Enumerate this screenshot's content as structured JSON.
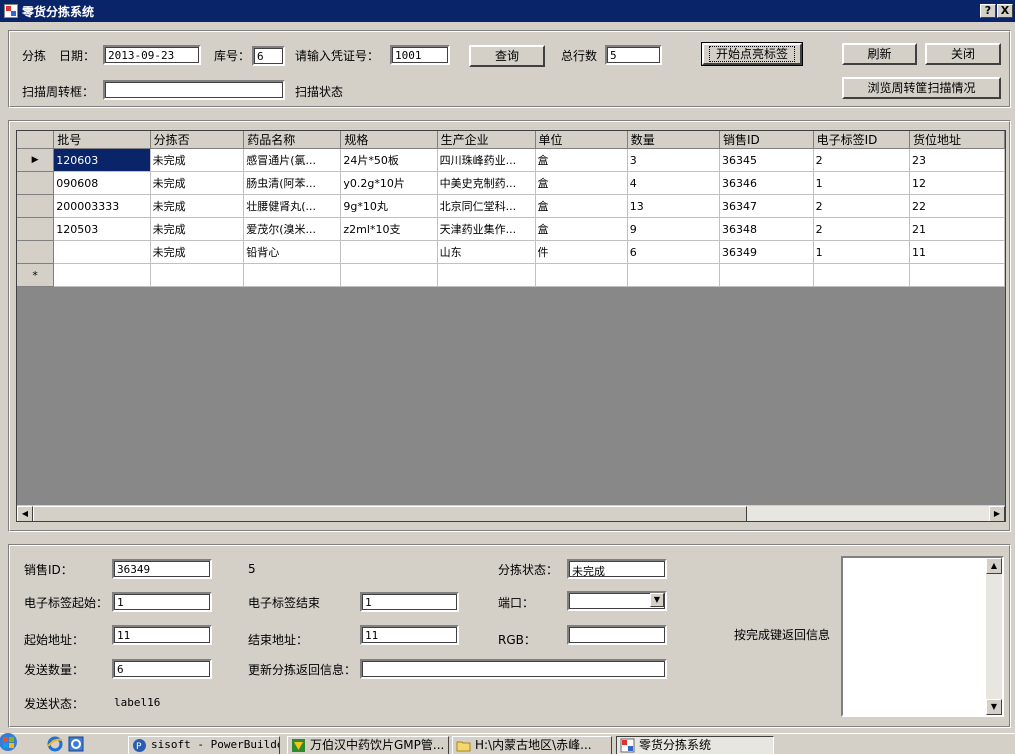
{
  "window": {
    "title": "零货分拣系统",
    "help_btn": "?",
    "close_btn": "X"
  },
  "top": {
    "fenjian_label": "分拣",
    "date_label": "日期：",
    "date_value": "2013-09-23",
    "kuhao_label": "库号：",
    "kuhao_value": "6",
    "voucher_label": "请输入凭证号：",
    "voucher_value": "1001",
    "query_btn": "查询",
    "total_label": "总行数",
    "total_value": "5",
    "start_btn": "开始点亮标签",
    "refresh_btn": "刷新",
    "close_btn": "关闭",
    "scan_label": "扫描周转框：",
    "scan_value": "",
    "scan_status": "扫描状态",
    "browse_btn": "浏览周转筐扫描情况"
  },
  "grid": {
    "columns": [
      "批号",
      "分拣否",
      "药品名称",
      "规格",
      "生产企业",
      "单位",
      "数量",
      "销售ID",
      "电子标签ID",
      "货位地址"
    ],
    "rows": [
      [
        "120603",
        "未完成",
        "感冒通片(氯...",
        "24片*50板",
        "四川珠峰药业...",
        "盒",
        "3",
        "36345",
        "2",
        "23"
      ],
      [
        "090608",
        "未完成",
        "肠虫清(阿苯...",
        "y0.2g*10片",
        "中美史克制药...",
        "盒",
        "4",
        "36346",
        "1",
        "12"
      ],
      [
        "200003333",
        "未完成",
        "壮腰健肾丸(...",
        "9g*10丸",
        "北京同仁堂科...",
        "盒",
        "13",
        "36347",
        "2",
        "22"
      ],
      [
        "120503",
        "未完成",
        "爱茂尔(溴米...",
        "z2ml*10支",
        "天津药业集作...",
        "盒",
        "9",
        "36348",
        "2",
        "21"
      ],
      [
        "",
        "未完成",
        "铅背心",
        "",
        "山东",
        "件",
        "6",
        "36349",
        "1",
        "11"
      ]
    ],
    "current_marker": "▶",
    "new_marker": "*"
  },
  "bottom": {
    "sale_id_label": "销售ID：",
    "sale_id_value": "36349",
    "count_text": "5",
    "sort_status_label": "分拣状态：",
    "sort_status_value": "未完成",
    "tag_start_label": "电子标签起始：",
    "tag_start_value": "1",
    "tag_end_label": "电子标签结束",
    "tag_end_value": "1",
    "port_label": "端口：",
    "port_value": "",
    "start_addr_label": "起始地址：",
    "start_addr_value": "11",
    "end_addr_label": "结束地址：",
    "end_addr_value": "11",
    "rgb_label": "RGB：",
    "rgb_value": "",
    "return_label": "按完成键返回信息",
    "send_qty_label": "发送数量：",
    "send_qty_value": "6",
    "update_label": "更新分拣返回信息：",
    "update_value": "",
    "send_status_label": "发送状态：",
    "send_status_value": "label16"
  },
  "taskbar": {
    "tasks": [
      "sisoft - PowerBuilder",
      "万伯汉中药饮片GMP管...",
      "H:\\内蒙古地区\\赤峰...",
      "零货分拣系统"
    ]
  },
  "colors": {
    "title_bg": "#0a246a",
    "face": "#d4d0c8",
    "grid_empty": "#888888",
    "selection": "#0a246a"
  }
}
